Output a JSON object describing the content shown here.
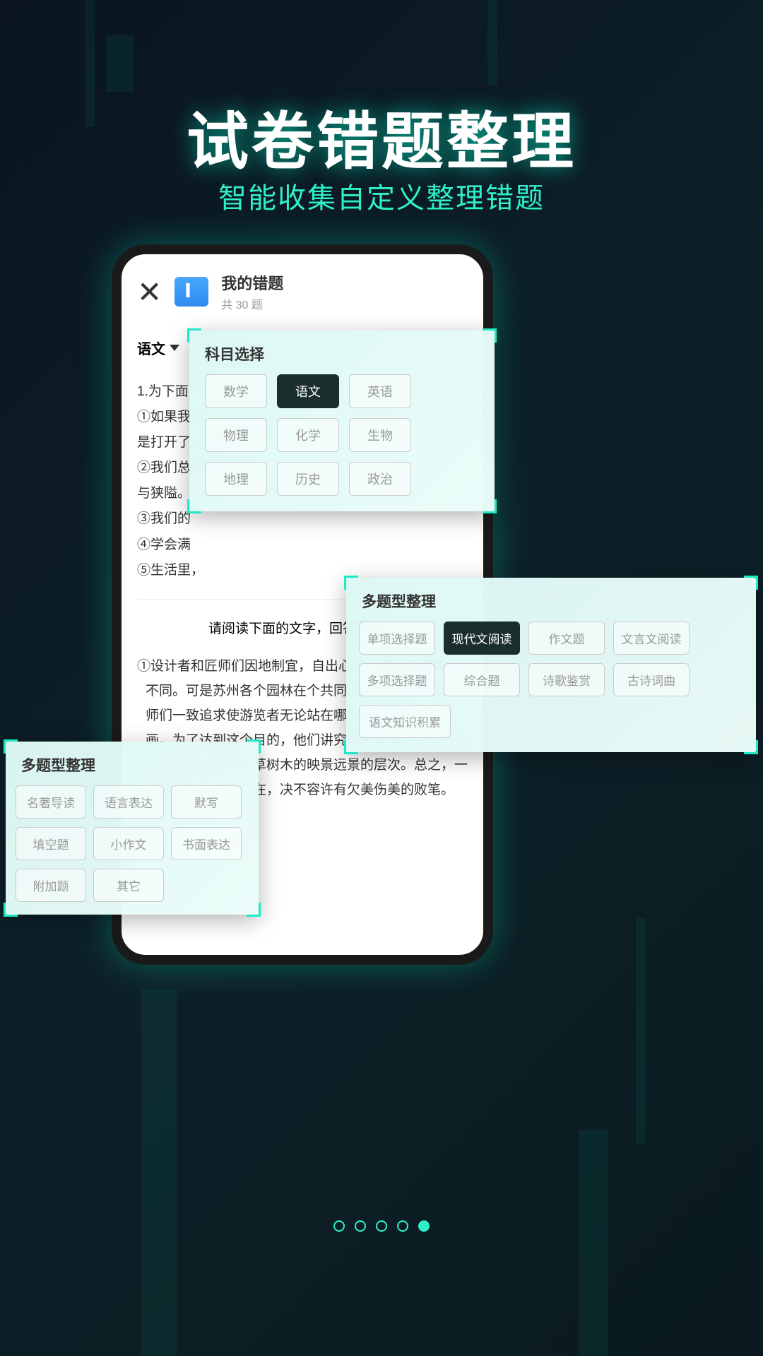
{
  "hero": {
    "title": "试卷错题整理",
    "subtitle": "智能收集自定义整理错题"
  },
  "app": {
    "title": "我的错题",
    "subtitle": "共 30 题",
    "subject": "语文",
    "question": {
      "l1": "1.为下面",
      "l2": "①如果我们",
      "l3": "是打开了一",
      "l4": "②我们总是",
      "l5": "与狭隘。",
      "l6": "③我们的",
      "l7": "④学会满",
      "l8": "⑤生活里，"
    },
    "reading_prompt": "请阅读下面的文字，回答问题。",
    "passage": "①设计者和匠师们因地制宜，自出心裁，园林当然各个不同。可是苏州各个园林在个共同点，似乎设计者和匠师们一致追求使游览者无论站在哪个点上，眼前总是画。为了达到这个目的，他们讲究亭台轩榭讲究假山池沼的配合，讲究花草树木的映景远景的层次。总之，一切都要为构成完存在，决不容许有欠美伤美的败笔。"
  },
  "subject_popup": {
    "title": "科目选择",
    "items": [
      "数学",
      "语文",
      "英语",
      "物理",
      "化学",
      "生物",
      "地理",
      "历史",
      "政治"
    ],
    "active": "语文"
  },
  "qtype_right": {
    "title": "多题型整理",
    "items": [
      "单项选择题",
      "现代文阅读",
      "作文题",
      "文言文阅读",
      "多项选择题",
      "综合题",
      "诗歌鉴赏",
      "古诗词曲",
      "语文知识积累"
    ],
    "active": "现代文阅读"
  },
  "qtype_left": {
    "title": "多题型整理",
    "items": [
      "名著导读",
      "语言表达",
      "默写",
      "填空题",
      "小作文",
      "书面表达",
      "附加题",
      "其它"
    ]
  },
  "pager": {
    "total": 5,
    "active": 4
  }
}
